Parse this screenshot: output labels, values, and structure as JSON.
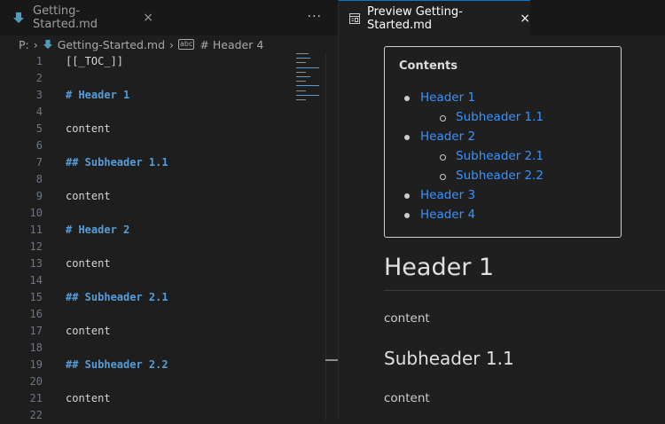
{
  "editor_group": {
    "tab": {
      "label": "Getting-Started.md",
      "close": "×"
    },
    "more_actions": "···",
    "breadcrumb": {
      "drive": "P:",
      "file": "Getting-Started.md",
      "symbol_icon": "abc",
      "symbol": "# Header 4"
    },
    "lines": [
      {
        "n": "1",
        "text": "[[_TOC_]]",
        "kind": "plain"
      },
      {
        "n": "2",
        "text": "",
        "kind": "plain"
      },
      {
        "n": "3",
        "text": "# Header 1",
        "kind": "heading"
      },
      {
        "n": "4",
        "text": "",
        "kind": "plain"
      },
      {
        "n": "5",
        "text": "content",
        "kind": "plain"
      },
      {
        "n": "6",
        "text": "",
        "kind": "plain"
      },
      {
        "n": "7",
        "text": "## Subheader 1.1",
        "kind": "heading"
      },
      {
        "n": "8",
        "text": "",
        "kind": "plain"
      },
      {
        "n": "9",
        "text": "content",
        "kind": "plain"
      },
      {
        "n": "10",
        "text": "",
        "kind": "plain"
      },
      {
        "n": "11",
        "text": "# Header 2",
        "kind": "heading"
      },
      {
        "n": "12",
        "text": "",
        "kind": "plain"
      },
      {
        "n": "13",
        "text": "content",
        "kind": "plain"
      },
      {
        "n": "14",
        "text": "",
        "kind": "plain"
      },
      {
        "n": "15",
        "text": "## Subheader 2.1",
        "kind": "heading"
      },
      {
        "n": "16",
        "text": "",
        "kind": "plain"
      },
      {
        "n": "17",
        "text": "content",
        "kind": "plain"
      },
      {
        "n": "18",
        "text": "",
        "kind": "plain"
      },
      {
        "n": "19",
        "text": "## Subheader 2.2",
        "kind": "heading"
      },
      {
        "n": "20",
        "text": "",
        "kind": "plain"
      },
      {
        "n": "21",
        "text": "content",
        "kind": "plain"
      },
      {
        "n": "22",
        "text": "",
        "kind": "plain"
      }
    ]
  },
  "preview_group": {
    "tab": {
      "label": "Preview Getting-Started.md",
      "close": "×"
    },
    "toc": {
      "title": "Contents",
      "items": [
        {
          "label": "Header 1",
          "level": 1
        },
        {
          "label": "Subheader 1.1",
          "level": 2
        },
        {
          "label": "Header 2",
          "level": 1
        },
        {
          "label": "Subheader 2.1",
          "level": 2
        },
        {
          "label": "Subheader 2.2",
          "level": 2
        },
        {
          "label": "Header 3",
          "level": 1
        },
        {
          "label": "Header 4",
          "level": 1
        }
      ]
    },
    "h1": "Header 1",
    "p1": "content",
    "h2": "Subheader 1.1",
    "p2": "content"
  },
  "colors": {
    "link": "#3794ff",
    "heading_syntax": "#569cd6",
    "active_tab_border": "#0078d4",
    "markdown_icon": "#519aba"
  }
}
